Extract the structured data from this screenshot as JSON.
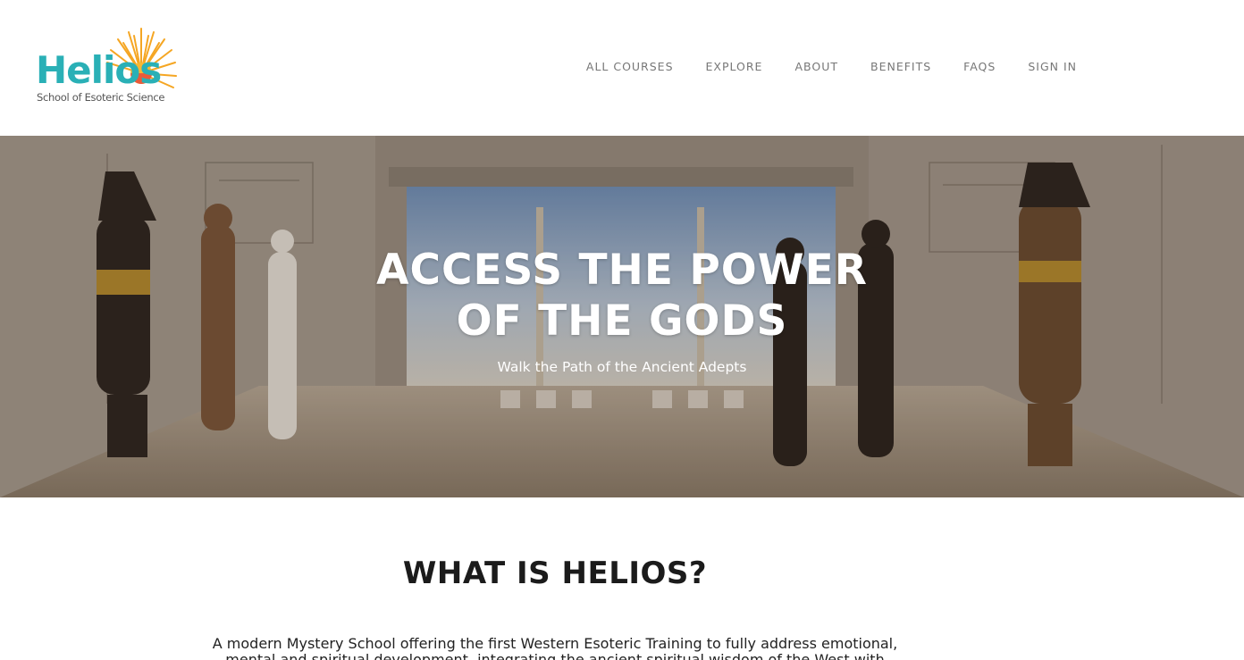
{
  "logo": {
    "name": "Helios",
    "tagline": "School of Esoteric Science",
    "colors": {
      "word": "#2ab0b6",
      "sun": "#f5a623"
    }
  },
  "nav": {
    "items": [
      "ALL COURSES",
      "EXPLORE",
      "ABOUT",
      "BENEFITS",
      "FAQS",
      "SIGN IN"
    ]
  },
  "hero": {
    "title_line1": "ACCESS THE POWER",
    "title_line2": "OF THE GODS",
    "subtitle": "Walk the Path of the Ancient Adepts"
  },
  "about": {
    "heading": "WHAT IS HELIOS?",
    "body": "A modern Mystery School offering the first Western Esoteric Training to fully address emotional, mental and spiritual development, integrating the ancient spiritual wisdom of the West with"
  }
}
